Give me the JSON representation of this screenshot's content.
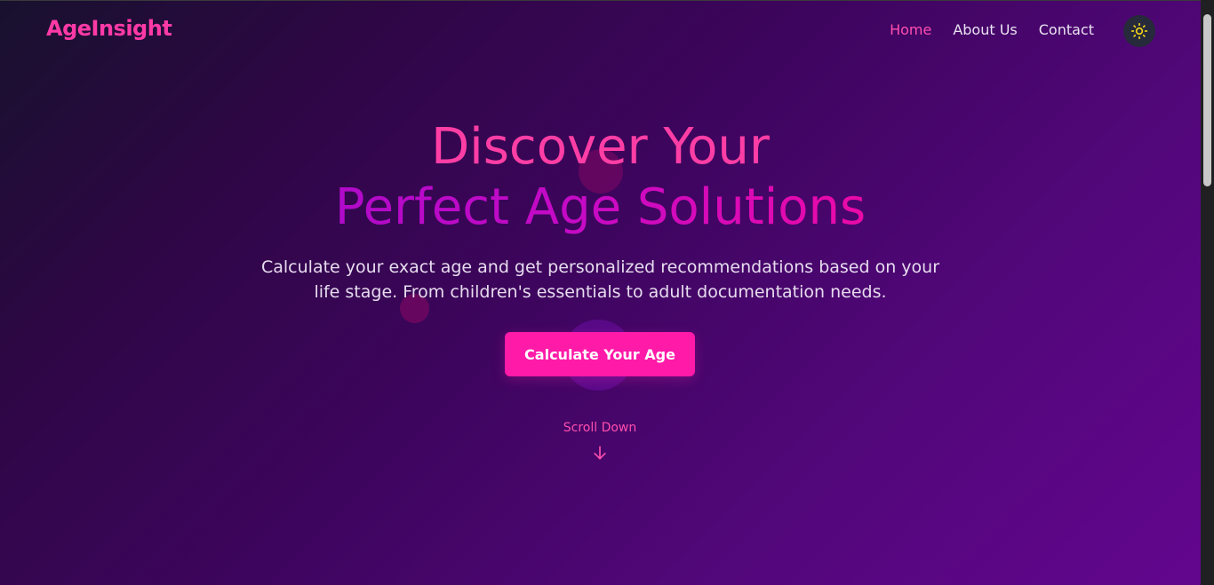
{
  "header": {
    "logo": "AgeInsight",
    "nav": [
      {
        "label": "Home",
        "active": true
      },
      {
        "label": "About Us",
        "active": false
      },
      {
        "label": "Contact",
        "active": false
      }
    ],
    "theme_toggle_icon": "sun-icon"
  },
  "hero": {
    "title_line1": "Discover Your",
    "title_line2": "Perfect Age Solutions",
    "subtitle": "Calculate your exact age and get personalized recommendations based on your life stage. From children's essentials to adult documentation needs.",
    "cta_label": "Calculate Your Age",
    "scroll_label": "Scroll Down",
    "scroll_icon": "arrow-down-icon"
  },
  "colors": {
    "accent": "#ff1aa8",
    "logo": "#ff3aa6",
    "nav_active": "#ff4fb0",
    "title_line1": "#ff3ea5",
    "title_line2_start": "#b00ac9",
    "title_line2_end": "#ea0aa8",
    "background_start": "#18112e",
    "background_end": "#63068f"
  }
}
